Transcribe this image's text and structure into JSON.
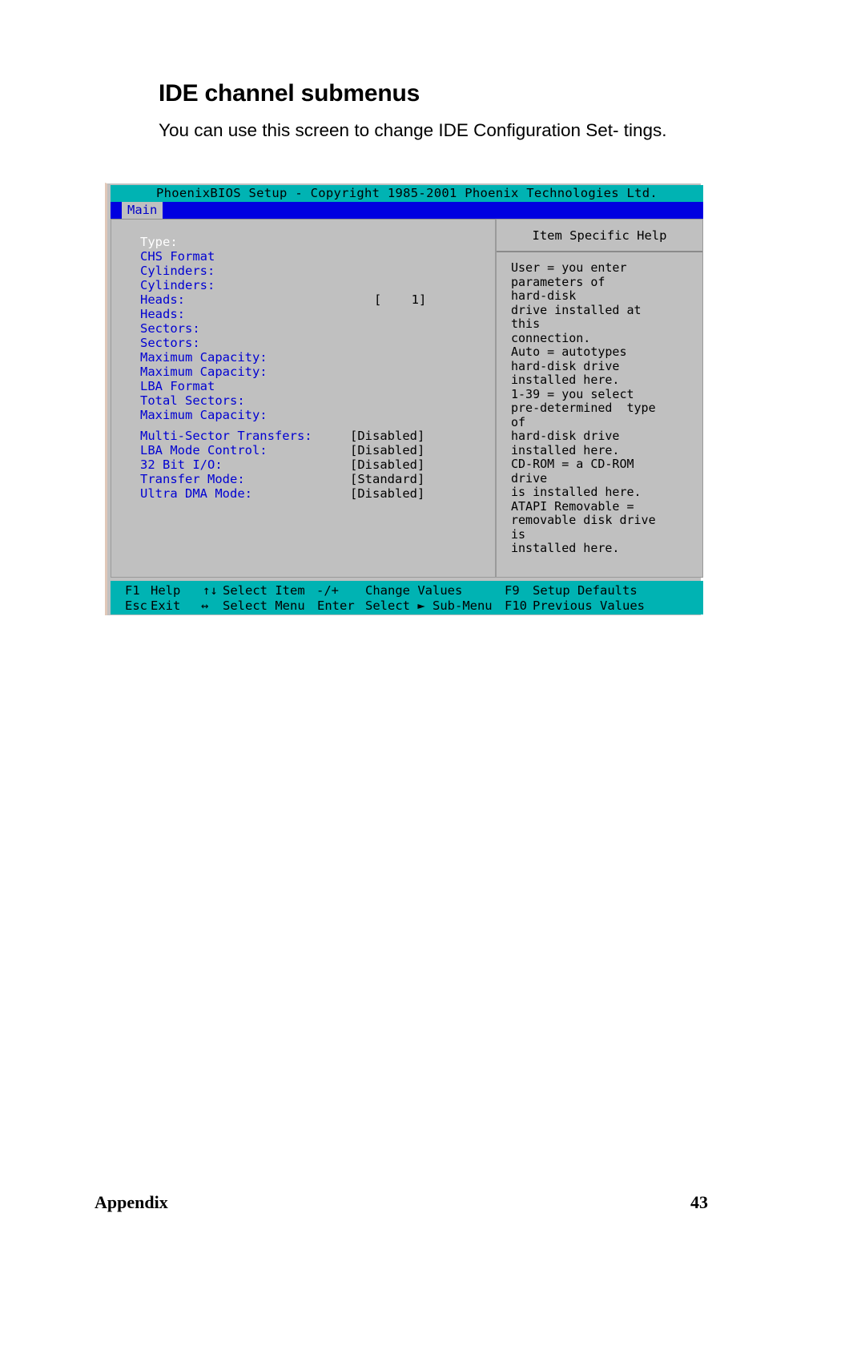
{
  "document": {
    "heading": "IDE channel submenus",
    "paragraph": "You can use this screen to change IDE Configuration Set-\ntings.",
    "footer_left": "Appendix",
    "footer_page": "43"
  },
  "bios": {
    "titlebar": "PhoenixBIOS Setup - Copyright 1985-2001 Phoenix Technologies Ltd.",
    "menu": {
      "active_tab": "Main"
    },
    "help_panel": {
      "title": "Item Specific Help",
      "body": "User = you enter\nparameters of\nhard-disk\ndrive installed at\nthis\nconnection.\nAuto = autotypes\nhard-disk drive\ninstalled here.\n1-39 = you select\npre-determined  type\nof\nhard-disk drive\ninstalled here.\nCD-ROM = a CD-ROM\ndrive\nis installed here.\nATAPI Removable =\nremovable disk drive\nis\ninstalled here."
    },
    "settings": [
      {
        "label": "Type:",
        "value": "",
        "selected": true
      },
      {
        "label": "CHS Format",
        "value": "",
        "selected": false
      },
      {
        "label": "Cylinders:",
        "value": "",
        "selected": false
      },
      {
        "label": "Cylinders:",
        "value": "",
        "selected": false
      },
      {
        "label": "Heads:",
        "value": "[    1]",
        "selected": false
      },
      {
        "label": "Heads:",
        "value": "",
        "selected": false
      },
      {
        "label": "Sectors:",
        "value": "",
        "selected": false
      },
      {
        "label": "Sectors:",
        "value": "",
        "selected": false
      },
      {
        "label": "Maximum Capacity:",
        "value": "",
        "selected": false
      },
      {
        "label": "Maximum Capacity:",
        "value": "",
        "selected": false
      },
      {
        "label": "LBA Format",
        "value": "",
        "selected": false
      },
      {
        "label": "Total Sectors:",
        "value": "",
        "selected": false
      },
      {
        "label": "Maximum Capacity:",
        "value": "",
        "selected": false
      }
    ],
    "settings2": [
      {
        "label": "Multi-Sector Transfers:",
        "value": "[Disabled]"
      },
      {
        "label": "LBA Mode Control:",
        "value": "[Disabled]"
      },
      {
        "label": "32 Bit I/O:",
        "value": "[Disabled]"
      },
      {
        "label": "Transfer Mode:",
        "value": "[Standard]"
      },
      {
        "label": "Ultra DMA Mode:",
        "value": "[Disabled]"
      }
    ],
    "keybar": {
      "row1": [
        {
          "key": "F1",
          "action": "Help"
        },
        {
          "key": "↑↓",
          "action": "Select Item"
        },
        {
          "key": "-/+",
          "action": "Change Values"
        },
        {
          "key": "F9",
          "action": "Setup Defaults"
        }
      ],
      "row2": [
        {
          "key": "Esc",
          "action": "Exit"
        },
        {
          "key": "↔",
          "action": "Select Menu"
        },
        {
          "key": "Enter",
          "action": "Select ► Sub-Menu"
        },
        {
          "key": "F10",
          "action": "Previous Values"
        }
      ]
    }
  },
  "colors": {
    "bios_bg": "#c0c0c0",
    "bios_teal": "#00b3b3",
    "bios_blue": "#0000e0",
    "label_blue": "#0000d2",
    "selected_white": "#ffffff"
  }
}
